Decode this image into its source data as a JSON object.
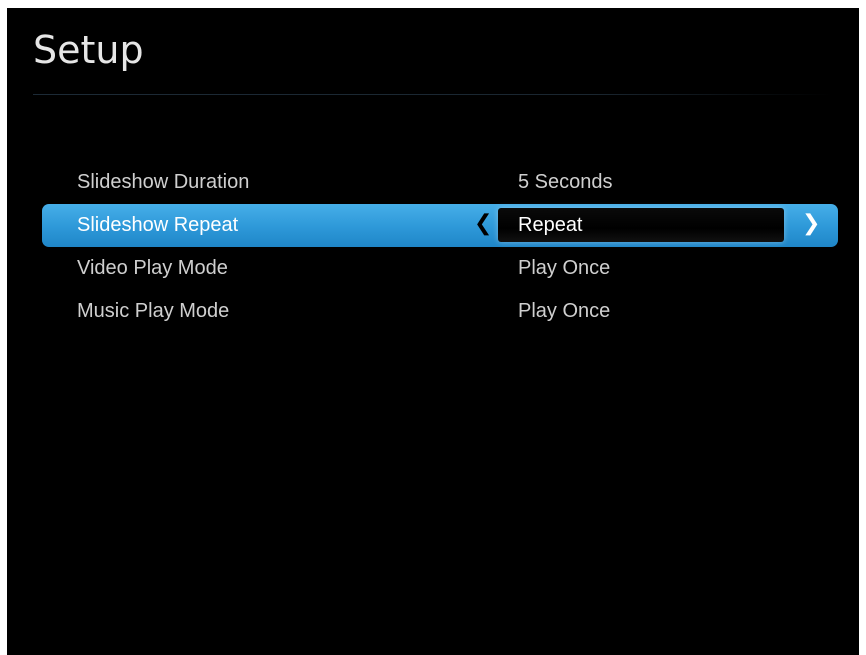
{
  "header": {
    "title": "Setup"
  },
  "settings": [
    {
      "label": "Slideshow Duration",
      "value": "5 Seconds",
      "selected": false
    },
    {
      "label": "Slideshow Repeat",
      "value": "Repeat",
      "selected": true
    },
    {
      "label": "Video Play Mode",
      "value": "Play Once",
      "selected": false
    },
    {
      "label": "Music Play Mode",
      "value": "Play Once",
      "selected": false
    }
  ],
  "icons": {
    "prev": "chevron-left-icon",
    "next": "chevron-right-icon"
  },
  "colors": {
    "background": "#000000",
    "highlight": "#2d98d8",
    "text": "#cfcfcf"
  }
}
